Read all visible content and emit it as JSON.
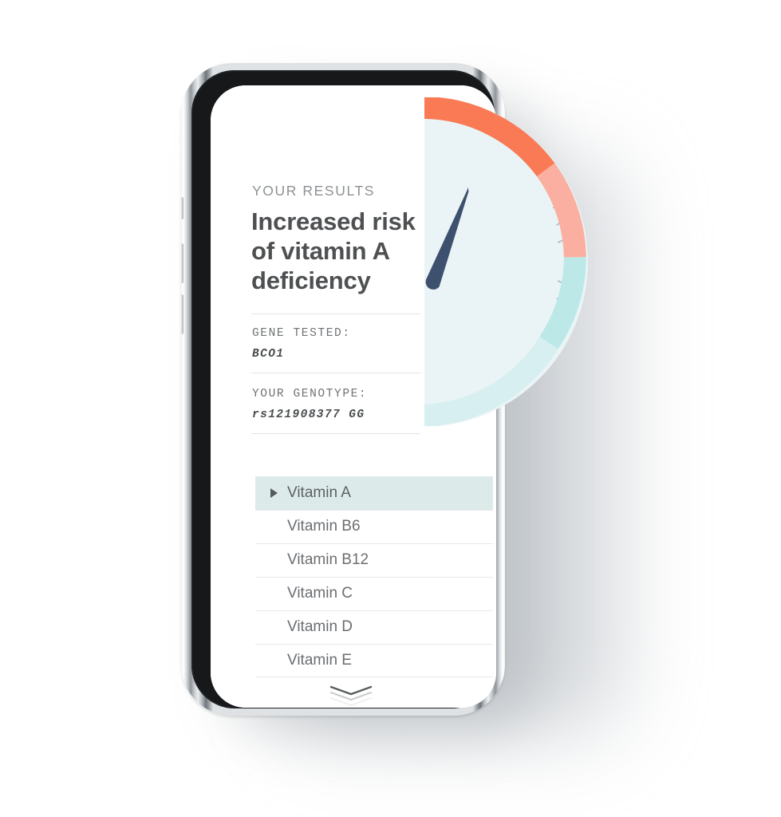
{
  "device": {
    "name": "smartphone-mockup",
    "frame_color": "#dfe2e4",
    "bezel_color": "#16181a",
    "screen_background": "#ffffff"
  },
  "screen": {
    "eyebrow": "YOUR RESULTS",
    "headline": "Increased risk of vitamin A deficiency",
    "meta": [
      {
        "label": "GENE TESTED:",
        "value": "BCO1"
      },
      {
        "label": "YOUR GENOTYPE:",
        "value": "rs121908377  GG"
      }
    ],
    "list": {
      "name": "vitamin-list",
      "selected_index": 0,
      "items": [
        {
          "label": "Vitamin A"
        },
        {
          "label": "Vitamin B6"
        },
        {
          "label": "Vitamin B12"
        },
        {
          "label": "Vitamin C"
        },
        {
          "label": "Vitamin D"
        },
        {
          "label": "Vitamin E"
        }
      ]
    },
    "scroll_hint": {
      "name": "scroll-down-chevrons",
      "glyph": "chevron-down"
    }
  },
  "gauge": {
    "name": "risk-gauge",
    "face_color": "#eaf4f6",
    "needle_color": "#3d516e",
    "tick_color": "#aab6bb",
    "segments": [
      {
        "name": "high-risk",
        "color": "#f97a54"
      },
      {
        "name": "elevated-risk",
        "color": "#fbafa1"
      },
      {
        "name": "moderate",
        "color": "#bce8e8"
      },
      {
        "name": "low-risk",
        "color": "#d7eff0"
      }
    ]
  },
  "colors": {
    "accent_orange": "#f97a54",
    "accent_salmon": "#fbafa1",
    "accent_cyan": "#bce8e8",
    "accent_pale_cyan": "#d7eff0",
    "highlight": "#dcebea",
    "text_dark": "#4e5052",
    "text_muted": "#8e9294"
  }
}
